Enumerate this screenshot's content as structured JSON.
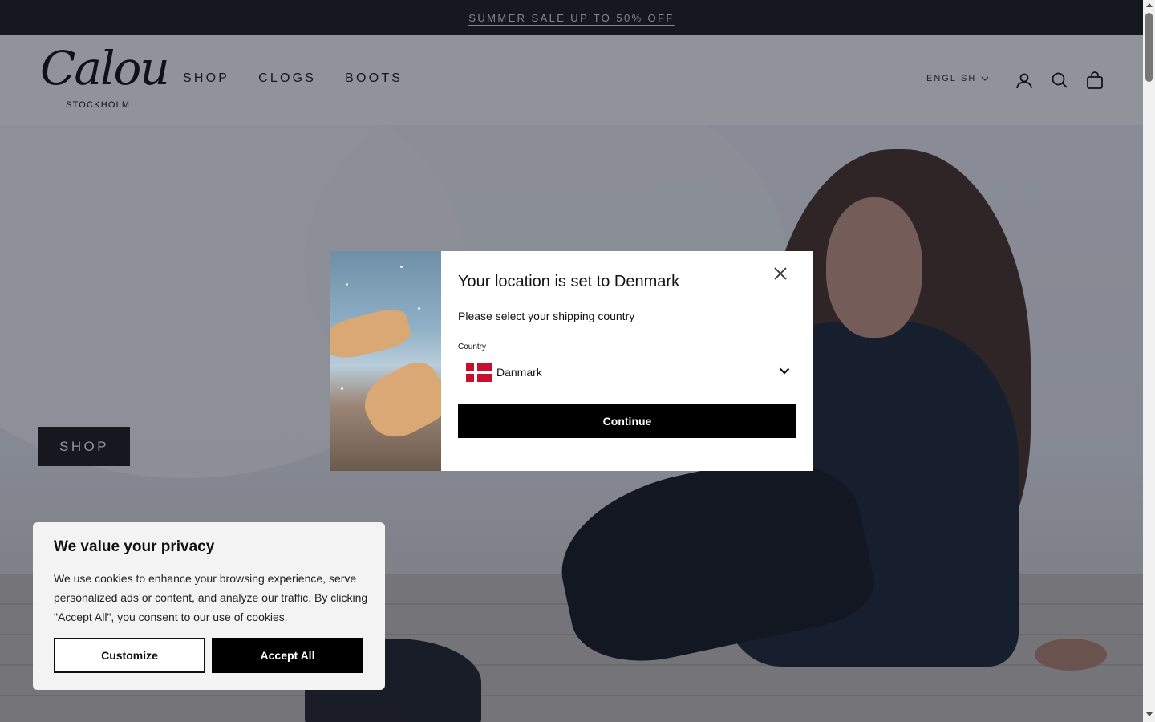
{
  "announcement": {
    "text": "SUMMER SALE UP TO 50% OFF"
  },
  "header": {
    "logo_script": "Calou",
    "logo_sub": "STOCKHOLM",
    "nav": [
      {
        "label": "SHOP"
      },
      {
        "label": "CLOGS"
      },
      {
        "label": "BOOTS"
      }
    ],
    "language": "ENGLISH",
    "icons": [
      "account-icon",
      "search-icon",
      "cart-icon"
    ]
  },
  "hero": {
    "button_label": "SHOP"
  },
  "location_modal": {
    "title": "Your location is set to Denmark",
    "subtitle": "Please select your shipping country",
    "country_label": "Country",
    "country_value": "Danmark",
    "continue_label": "Continue"
  },
  "cookie_banner": {
    "title": "We value your privacy",
    "text": "We use cookies to enhance your browsing experience, serve personalized ads or content, and analyze our traffic. By clicking \"Accept All\", you consent to our use of cookies.",
    "customize_label": "Customize",
    "accept_label": "Accept All"
  },
  "colors": {
    "announcement_bg": "#1c1c1c",
    "overlay": "#101424",
    "primary_button": "#000000",
    "flag_red": "#c8102e"
  }
}
